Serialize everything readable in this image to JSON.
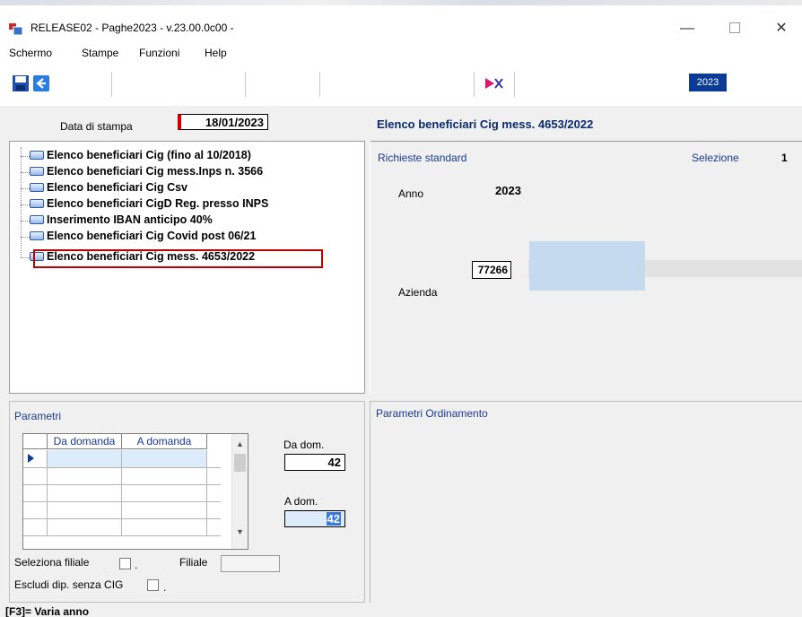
{
  "window": {
    "title": "RELEASE02 - Paghe2023 - v.23.00.0c00 -"
  },
  "menu": [
    "Schermo",
    "Stampe",
    "Funzioni",
    "Help"
  ],
  "toolbar": {
    "year": "2023"
  },
  "header": {
    "date_label": "Data di stampa",
    "date_value": "18/01/2023",
    "report_title": "Elenco beneficiari Cig mess. 4653/2022"
  },
  "tree": {
    "items": [
      "Elenco beneficiari Cig (fino al 10/2018)",
      "Elenco beneficiari Cig mess.Inps n. 3566",
      "Elenco beneficiari Cig Csv",
      "Elenco beneficiari CigD Reg. presso INPS",
      "Inserimento IBAN anticipo 40%",
      "Elenco beneficiari Cig Covid post 06/21",
      "Elenco beneficiari Cig mess. 4653/2022"
    ]
  },
  "richieste": {
    "title": "Richieste standard",
    "selezione_label": "Selezione",
    "selezione_value": "1",
    "anno_label": "Anno",
    "anno_value": "2023",
    "azienda_label": "Azienda",
    "azienda_value": "77266"
  },
  "parametri": {
    "title": "Parametri",
    "columns": [
      "Da domanda",
      "A domanda"
    ],
    "da_dom_label": "Da dom.",
    "da_dom_value": "42",
    "a_dom_label": "A dom.",
    "a_dom_value": "42",
    "seleziona_filiale_label": "Seleziona filiale",
    "filiale_label": "Filiale",
    "escludi_label": "Escludi dip. senza CIG",
    "dot": "."
  },
  "ordinamento": {
    "title": "Parametri Ordinamento"
  },
  "status": {
    "text": "[F3]= Varia anno"
  },
  "colors": {
    "accent": "#0a3c96",
    "highlight": "#c00000",
    "label_blue": "#1a3a8e"
  }
}
